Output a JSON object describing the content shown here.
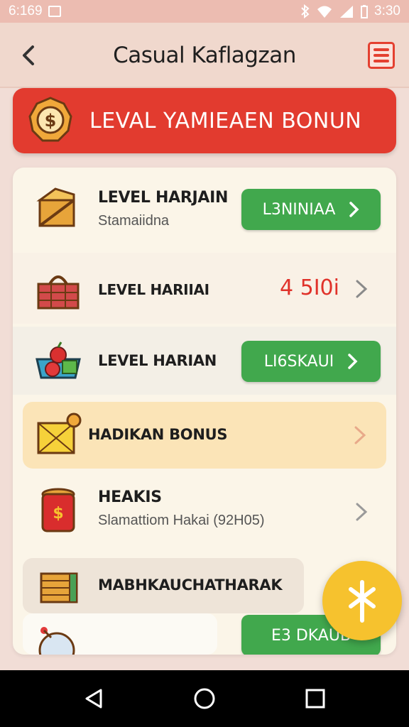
{
  "status_bar": {
    "time_left": "6:169",
    "time_right": "3:30"
  },
  "app_bar": {
    "title": "Casual Kaflagzan"
  },
  "banner": {
    "text": "LEVAL YAMIEAEN BONUN",
    "icon": "coin-badge-icon"
  },
  "list": [
    {
      "label": "LEVEL HARJAIN",
      "subtitle": "Stamaiidna",
      "action_label": "L3NINIAA",
      "icon": "treasure-chest-icon"
    },
    {
      "label": "LEVEL HARIIAI",
      "amount": "4 5I0i",
      "icon": "basket-icon"
    },
    {
      "label": "LEVEL HARIAN",
      "action_label": "LI6SKAUI",
      "icon": "fruit-bowl-icon"
    },
    {
      "label": "HADIKAN BONUS",
      "icon": "gift-box-icon"
    },
    {
      "label": "HEAKIS",
      "subtitle": "Slamattiom Hakai (92H05)",
      "icon": "money-bag-icon"
    },
    {
      "label": "MABHKAUCHATHARAK",
      "icon": "crate-icon"
    },
    {
      "action_label": "E3 DKAUB",
      "icon": "globe-icon"
    }
  ],
  "colors": {
    "accent_red": "#e23b2f",
    "accent_green": "#41a84d",
    "fab_yellow": "#f6c22e",
    "highlight_row": "#fbe4b7"
  }
}
